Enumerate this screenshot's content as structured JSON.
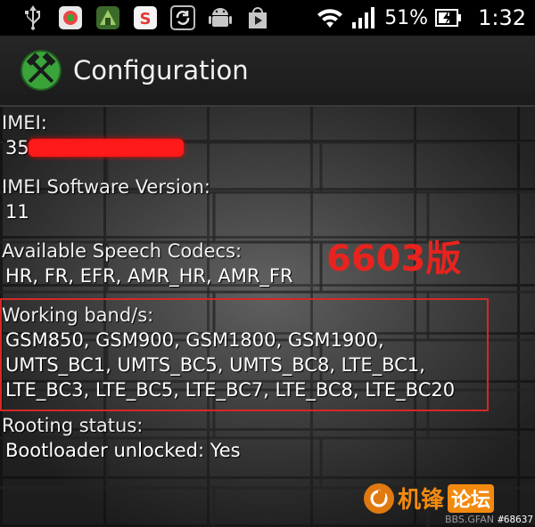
{
  "status_bar": {
    "battery_percent": "51%",
    "time": "1:32",
    "icons": [
      "usb-icon",
      "app-icon",
      "game-icon",
      "s-app-icon",
      "sync-icon",
      "android-icon",
      "play-store-icon",
      "wifi-icon",
      "signal-icon",
      "battery-charging-icon"
    ]
  },
  "action_bar": {
    "title": "Configuration",
    "logo_icon": "crossed-hammers-icon"
  },
  "config": {
    "imei_label": "IMEI:",
    "imei_value": "355",
    "imei_sw_label": "IMEI Software Version:",
    "imei_sw_value": "11",
    "codecs_label": "Available Speech Codecs:",
    "codecs_value": "HR, FR, EFR, AMR_HR, AMR_FR",
    "bands_label": "Working band/s:",
    "bands_value": "GSM850, GSM900, GSM1800, GSM1900, UMTS_BC1, UMTS_BC5, UMTS_BC8, LTE_BC1, LTE_BC3, LTE_BC5, LTE_BC7, LTE_BC8, LTE_BC20",
    "rooting_label": "Rooting status:",
    "rooting_value": "Bootloader unlocked: Yes"
  },
  "annotation": {
    "text": "6603版",
    "color": "#e8231e"
  },
  "watermark": {
    "brand": "机锋",
    "tag": "论坛",
    "domain": "BBS.GFAN",
    "image_id": "#68637"
  },
  "colors": {
    "accent_red": "#d62828",
    "watermark_orange": "#f28a10"
  }
}
